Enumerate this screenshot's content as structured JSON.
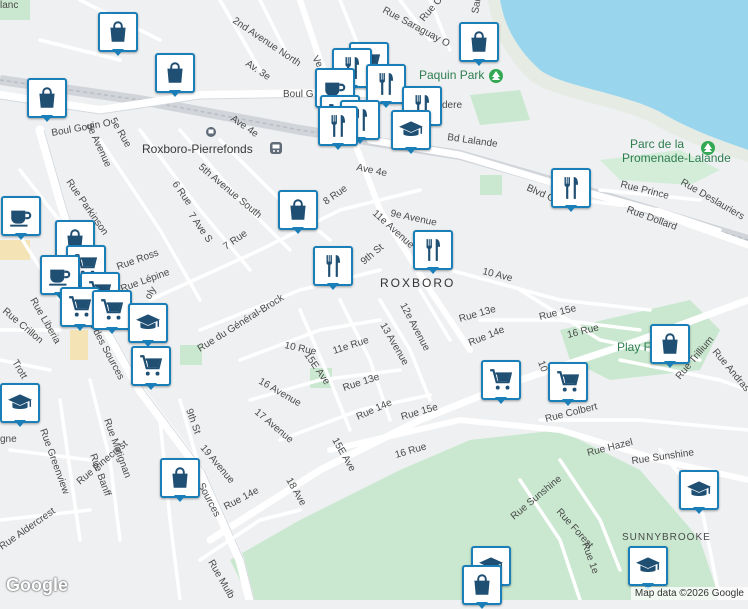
{
  "map": {
    "places": {
      "roxboro_pierrefonds": "Roxboro-Pierrefonds",
      "roxboro": "ROXBORO",
      "paquin_park": "Paquin Park",
      "promenade_lalande_1": "Parc de la",
      "promenade_lalande_2": "Promenade-Lalande",
      "play_fountain": "Play Foun",
      "sunnybrooke": "SUNNYBROOKE",
      "blanc": "lanc"
    },
    "streets": {
      "boul_gouin_o": "Boul Gouin O",
      "boul_g": "Boul G",
      "bd_lalande": "Bd Lalande",
      "blvd_gouin": "Blvd Gouin",
      "ave_4e_a": "Ave 4e",
      "ave_4e_b": "Ave 4e",
      "av_3e": "Av. 3e",
      "second_avenue_north": "2nd Avenue North",
      "fifth_avenue_south": "5th Avenue South",
      "rue_8": "8 Rue",
      "ave_9": "9e Avenue",
      "st_9th": "9th St",
      "ave_11e": "11e Avenue",
      "ave_10": "10 Ave",
      "rue_prince": "Rue Prince",
      "rue_dollard": "Rue Dollard",
      "rue_deslauriers": "Rue Deslauriers",
      "rue_6": "6 Rue",
      "ave_s_7": "7 Ave S",
      "rue_7": "7 Rue",
      "rue_parkinson": "Rue Parkinson",
      "rue_5e": "5e Rue",
      "ave_8e": "8e Avenue",
      "rue_ross": "Rue Ross",
      "rue_lepine": "Rue Lépine",
      "rue_general_brock": "Rue du Général-Brock",
      "rue_10": "10 Rue",
      "ave_15e": "15E Ave",
      "rue_11e": "11e Rue",
      "ave_13": "13 Avenue",
      "ave_12e": "12e Avenue",
      "rue_13e": "Rue 13e",
      "rue_13e_b": "Rue 13e",
      "rue_14e": "Rue 14e",
      "rue_14e_b": "Rue 14e",
      "rue_14e_c": "Rue 14e",
      "rue_15e": "Rue 15e",
      "rue_15e_b": "Rue 15e",
      "rue_16": "16 Rue",
      "rue_16_b": "16 Rue",
      "ave_16": "16 Avenue",
      "ave_17": "17 Avenue",
      "ave_19": "19 Avenue",
      "st_9th_b": "9th St",
      "ave_18": "18 Ave",
      "ave_15e_b": "15E Ave",
      "rue_crillon": "Rue Crillon",
      "rue_liberia": "Rue Liberia",
      "bd_des_sources": "Bd des Sources",
      "sources": "Sources",
      "rue_matignan": "Rue Matignan",
      "rue_greenview": "Rue Greenview",
      "rue_banff": "Rue Banff",
      "rue_pinecrest": "Rue Pinecrest",
      "rue_aldercrest": "Rue Aldercrest",
      "rue_hazel": "Rue Hazel",
      "rue_sunshine": "Rue Sunshine",
      "rue_sunshine_b": "Rue Sunshine",
      "rue_forest": "Rue Forest",
      "rue_colbert": "Rue Colbert",
      "rue_trillium": "Rue Trillium",
      "rue_andras": "Rue Andras",
      "rue_saraguay": "Rue Saraguay O",
      "rue_ch": "Rue Ch",
      "sara": "Sara",
      "dere": "dere",
      "rue_mulb": "Rue Mulb",
      "ve": "Ve",
      "gne": "gne",
      "rue_1er": "Rue 1e",
      "trott": "Trott",
      "er": "er",
      "oly": "oly",
      "ave_14": "10"
    },
    "attribution": "Map data ©2026 Google",
    "logo": "Google"
  },
  "markers": {
    "shopping": "shopping-bag",
    "restaurant": "fork-knife",
    "cafe": "coffee-cup",
    "grocery": "shopping-cart",
    "school": "graduation-cap"
  },
  "colors": {
    "water": "#99d6ee",
    "park": "#c9e8cf",
    "road": "#ffffff",
    "highway": "#d7dbe0",
    "pin_border": "#1a7fb8",
    "icon": "#1f4f73"
  }
}
